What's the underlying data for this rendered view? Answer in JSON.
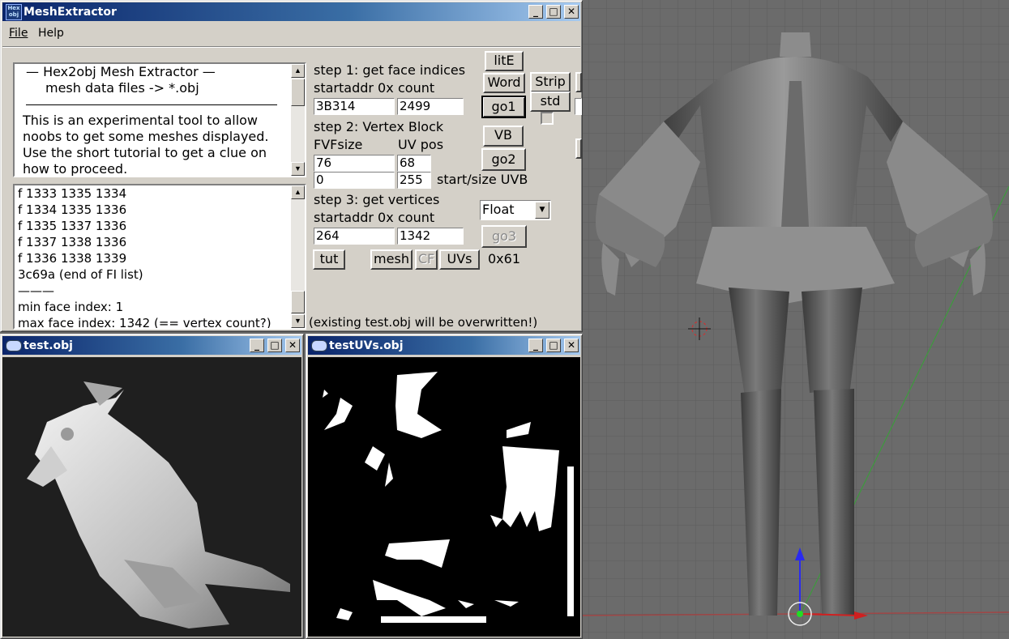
{
  "main_window": {
    "title": "MeshExtractor",
    "icon_text": "Hex obj",
    "menu": [
      "File",
      "Help"
    ],
    "info_text": {
      "heading1": "—   Hex2obj Mesh Extractor   —",
      "heading2": "mesh data files -> *.obj",
      "lines": [
        "This is an experimental tool to allow",
        "noobs to get some meshes displayed.",
        "Use the short tutorial to get a clue on",
        "how to proceed."
      ]
    },
    "log_lines": [
      "f  1333 1335 1334",
      "f  1334 1335 1336",
      "f  1335 1337 1336",
      "f  1337 1338 1336",
      "f  1336 1338 1339",
      "3c69a (end of FI list)",
      "———",
      "min face index: 1",
      "max face index: 1342 (== vertex count?)"
    ],
    "step1": {
      "title": "step 1: get face indices",
      "addr_label": "startaddr 0x",
      "count_label": "count",
      "addr": "3B314",
      "count": "2499"
    },
    "step2": {
      "title": "step 2: Vertex Block",
      "fvf_label": "FVFsize",
      "uv_label": "UV pos",
      "fvf": "76",
      "uv": "68",
      "start": "0",
      "size": "255",
      "uvb_label": "start/size UVB"
    },
    "step3": {
      "title": "step 3: get vertices",
      "addr_label": "startaddr 0x",
      "count_label": "count",
      "addr": "264",
      "count": "1342",
      "type": "Float"
    },
    "buttons": {
      "lite": "litE",
      "word": "Word",
      "strip": "Strip",
      "go1": "go1",
      "std": "std",
      "vb": "VB",
      "go2": "go2",
      "go3": "go3",
      "tut": "tut",
      "mesh": "mesh",
      "cf": "CF",
      "uvs": "UVs"
    },
    "hex_value": "0x61",
    "status": "(existing test.obj will be overwritten!)"
  },
  "test_window": {
    "title": "test.obj"
  },
  "uv_window": {
    "title": "testUVs.obj"
  },
  "colors": {
    "title_start": "#0a246a",
    "title_end": "#a6caf0",
    "window_face": "#d4d0c8",
    "viewport_bg": "#6a6a6a"
  }
}
